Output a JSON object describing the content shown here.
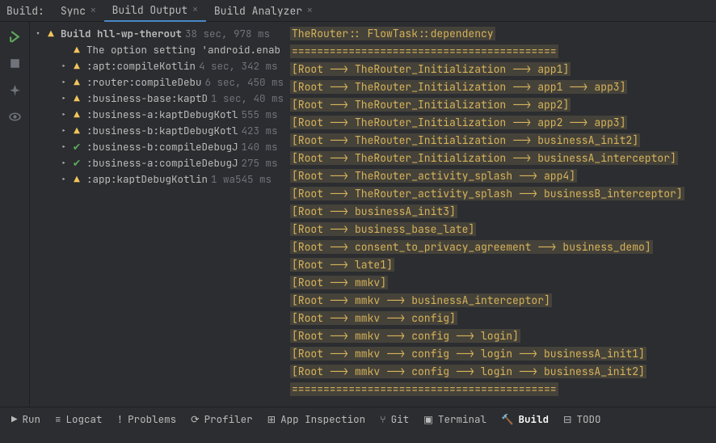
{
  "tabs": {
    "label": "Build:",
    "items": [
      {
        "label": "Sync",
        "active": false
      },
      {
        "label": "Build Output",
        "active": true
      },
      {
        "label": "Build Analyzer",
        "active": false
      }
    ]
  },
  "tree": {
    "root": {
      "label": "Build hll-wp-therout",
      "meta": "38 sec, 978 ms",
      "icon": "warn",
      "open": true,
      "bold": true,
      "indent": 0
    },
    "children": [
      {
        "label": "The option setting 'android.enab",
        "meta": "",
        "icon": "warn",
        "chev": false,
        "indent": 1
      },
      {
        "label": ":apt:compileKotlin",
        "meta": "4 sec, 342 ms",
        "icon": "warn",
        "chev": true,
        "indent": 1
      },
      {
        "label": ":router:compileDebu",
        "meta": "6 sec, 450 ms",
        "icon": "warn",
        "chev": true,
        "indent": 1
      },
      {
        "label": ":business-base:kaptD",
        "meta": "1 sec, 40 ms",
        "icon": "warn",
        "chev": true,
        "indent": 1
      },
      {
        "label": ":business-a:kaptDebugKotl",
        "meta": "555 ms",
        "icon": "warn",
        "chev": true,
        "indent": 1
      },
      {
        "label": ":business-b:kaptDebugKotl",
        "meta": "423 ms",
        "icon": "warn",
        "chev": true,
        "indent": 1
      },
      {
        "label": ":business-b:compileDebugJ",
        "meta": "140 ms",
        "icon": "ok",
        "chev": true,
        "indent": 1
      },
      {
        "label": ":business-a:compileDebugJ",
        "meta": "275 ms",
        "icon": "ok",
        "chev": true,
        "indent": 1
      },
      {
        "label": ":app:kaptDebugKotlin",
        "meta": "1 wa545 ms",
        "icon": "warn",
        "chev": true,
        "indent": 1
      }
    ]
  },
  "console": [
    "TheRouter:: FlowTask::dependency",
    "==========================================",
    "[Root --> TheRouter_Initialization --> app1]",
    "[Root --> TheRouter_Initialization --> app1 --> app3]",
    "[Root --> TheRouter_Initialization --> app2]",
    "[Root --> TheRouter_Initialization --> app2 --> app3]",
    "[Root --> TheRouter_Initialization --> businessA_init2]",
    "[Root --> TheRouter_Initialization --> businessA_interceptor]",
    "[Root --> TheRouter_activity_splash --> app4]",
    "[Root --> TheRouter_activity_splash --> businessB_interceptor]",
    "[Root --> businessA_init3]",
    "[Root --> business_base_late]",
    "[Root --> consent_to_privacy_agreement --> business_demo]",
    "[Root --> late1]",
    "[Root --> mmkv]",
    "[Root --> mmkv --> businessA_interceptor]",
    "[Root --> mmkv --> config]",
    "[Root --> mmkv --> config --> login]",
    "[Root --> mmkv --> config --> login --> businessA_init1]",
    "[Root --> mmkv --> config --> login --> businessA_init2]",
    "=========================================="
  ],
  "bottom": {
    "items": [
      {
        "icon": "▶",
        "label": "Run"
      },
      {
        "icon": "≡",
        "label": "Logcat"
      },
      {
        "icon": "!",
        "label": "Problems"
      },
      {
        "icon": "⟳",
        "label": "Profiler"
      },
      {
        "icon": "⊞",
        "label": "App Inspection"
      },
      {
        "icon": "⑂",
        "label": "Git"
      },
      {
        "icon": "▣",
        "label": "Terminal"
      },
      {
        "icon": "🔨",
        "label": "Build",
        "active": true
      },
      {
        "icon": "⊟",
        "label": "TODO"
      }
    ]
  },
  "status": ""
}
